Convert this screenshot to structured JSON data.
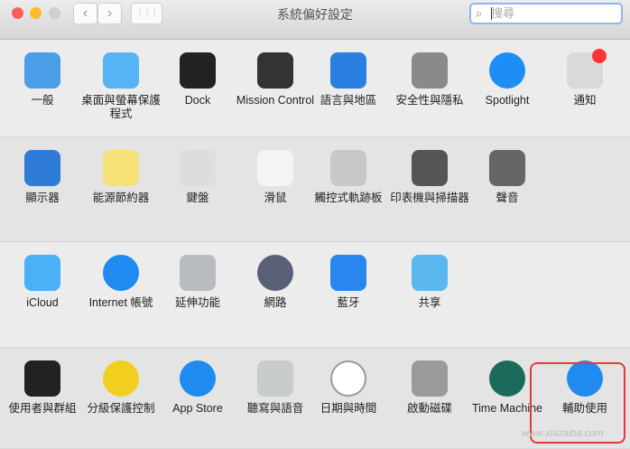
{
  "window": {
    "title": "系統偏好設定",
    "search_placeholder": "搜尋"
  },
  "toolbar": {
    "back": "‹",
    "forward": "›",
    "grid": "⋮⋮⋮"
  },
  "rows": [
    {
      "items": [
        {
          "label": "一般",
          "icon": "general-icon",
          "color": "#4a9ee8"
        },
        {
          "label": "桌面與螢幕保護程式",
          "icon": "desktop-screensaver-icon",
          "color": "#56b4f5"
        },
        {
          "label": "Dock",
          "icon": "dock-icon",
          "color": "#222222"
        },
        {
          "label": "Mission Control",
          "icon": "mission-control-icon",
          "color": "#333333"
        },
        {
          "label": "語言與地區",
          "icon": "language-region-icon",
          "color": "#2a7fe0"
        },
        {
          "label": "安全性與隱私",
          "icon": "security-privacy-icon",
          "color": "#8a8a8a"
        },
        {
          "label": "Spotlight",
          "icon": "spotlight-icon",
          "color": "#1c8ef5"
        },
        {
          "label": "通知",
          "icon": "notifications-icon",
          "color": "#d9d9d9"
        }
      ]
    },
    {
      "items": [
        {
          "label": "顯示器",
          "icon": "displays-icon",
          "color": "#2e7bd8"
        },
        {
          "label": "能源節約器",
          "icon": "energy-saver-icon",
          "color": "#f7e27a"
        },
        {
          "label": "鍵盤",
          "icon": "keyboard-icon",
          "color": "#dddddd"
        },
        {
          "label": "滑鼠",
          "icon": "mouse-icon",
          "color": "#f4f4f4"
        },
        {
          "label": "觸控式軌跡板",
          "icon": "trackpad-icon",
          "color": "#c8c8c8"
        },
        {
          "label": "印表機與掃描器",
          "icon": "printers-scanners-icon",
          "color": "#555555"
        },
        {
          "label": "聲音",
          "icon": "sound-icon",
          "color": "#666666"
        }
      ]
    },
    {
      "items": [
        {
          "label": "iCloud",
          "icon": "icloud-icon",
          "color": "#4ab0f7"
        },
        {
          "label": "Internet 帳號",
          "icon": "internet-accounts-icon",
          "color": "#1f8af0"
        },
        {
          "label": "延伸功能",
          "icon": "extensions-icon",
          "color": "#b8bcc0"
        },
        {
          "label": "網路",
          "icon": "network-icon",
          "color": "#5a5f78"
        },
        {
          "label": "藍牙",
          "icon": "bluetooth-icon",
          "color": "#2a86ef"
        },
        {
          "label": "共享",
          "icon": "sharing-icon",
          "color": "#5ab8ef"
        }
      ]
    },
    {
      "items": [
        {
          "label": "使用者與群組",
          "icon": "users-groups-icon",
          "color": "#222222"
        },
        {
          "label": "分級保護控制",
          "icon": "parental-controls-icon",
          "color": "#f2cf1f"
        },
        {
          "label": "App Store",
          "icon": "app-store-icon",
          "color": "#1f8af0"
        },
        {
          "label": "聽寫與語音",
          "icon": "dictation-speech-icon",
          "color": "#c9cccc"
        },
        {
          "label": "日期與時間",
          "icon": "date-time-icon",
          "color": "#ffffff"
        },
        {
          "label": "啟動磁碟",
          "icon": "startup-disk-icon",
          "color": "#9a9a9a"
        },
        {
          "label": "Time Machine",
          "icon": "time-machine-icon",
          "color": "#1a6b5a"
        },
        {
          "label": "輔助使用",
          "icon": "accessibility-icon",
          "color": "#1f8af0"
        }
      ]
    }
  ],
  "highlight_color": "#e53a3a",
  "watermark": "www.xiazaiba.com"
}
